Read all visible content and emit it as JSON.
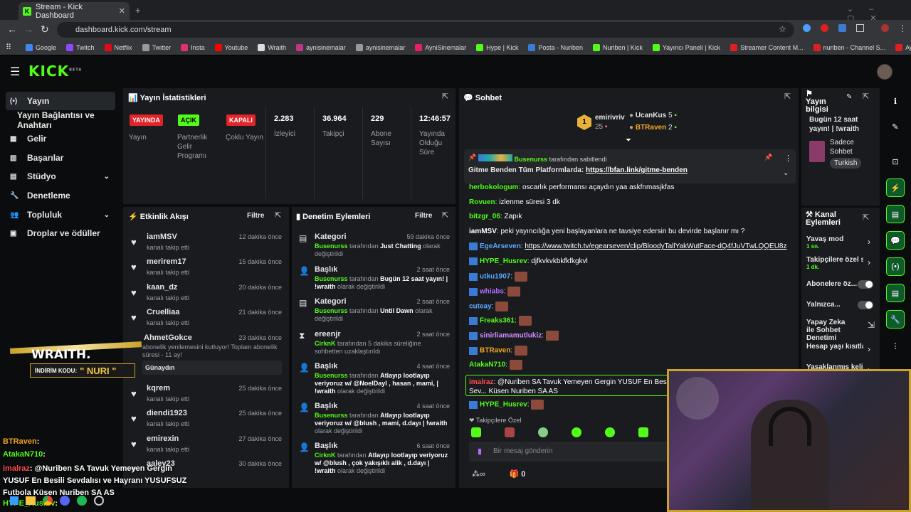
{
  "browser": {
    "tab_title": "Stream - Kick Dashboard",
    "url": "dashboard.kick.com/stream",
    "bookmarks": [
      "Google",
      "Twitch",
      "Netflix",
      "Twitter",
      "Insta",
      "Youtube",
      "Wraith",
      "aynisinemalar",
      "aynisinemalar",
      "AyniSinemalar",
      "Hype | Kick",
      "Posta - Nuriben",
      "Nuriben | Kick",
      "Yayıncı Paneli | Kick",
      "Streamer Content M...",
      "nuriben - Channel S...",
      "Aynı Sinemalar - Ça..."
    ]
  },
  "logo": "KICK",
  "logo_sup": "BETA",
  "sidebar": {
    "items": [
      {
        "label": "Yayın"
      },
      {
        "label": "Yayın Bağlantısı ve Anahtarı"
      },
      {
        "label": "Gelir"
      },
      {
        "label": "Başarılar"
      },
      {
        "label": "Stüdyo"
      },
      {
        "label": "Denetleme"
      },
      {
        "label": "Topluluk"
      },
      {
        "label": "Droplar ve ödüller"
      }
    ]
  },
  "stats": {
    "title": "Yayın İstatistikleri",
    "badges": [
      {
        "badge": "YAYINDA",
        "label": "Yayın"
      },
      {
        "badge": "AÇIK",
        "label": "Partnerlik Gelir Programı"
      },
      {
        "badge": "KAPALI",
        "label": "Çoklu Yayın"
      }
    ],
    "values": [
      {
        "value": "2.283",
        "label": "İzleyici"
      },
      {
        "value": "36.964",
        "label": "Takipçi"
      },
      {
        "value": "229",
        "label": "Abone Sayısı"
      },
      {
        "value": "12:46:57",
        "label": "Yayında Olduğu Süre"
      }
    ]
  },
  "activity": {
    "title": "Etkinlik Akışı",
    "filter": "Filtre",
    "items": [
      {
        "name": "iamMSV",
        "sub": "kanalı takip etti",
        "time": "12 dakika önce"
      },
      {
        "name": "merirem17",
        "sub": "kanalı takip etti",
        "time": "15 dakika önce"
      },
      {
        "name": "kaan_dz",
        "sub": "kanalı takip etti",
        "time": "20 dakika önce"
      },
      {
        "name": "Cruelliaa",
        "sub": "kanalı takip etti",
        "time": "21 dakika önce"
      },
      {
        "name": "AhmetGokce",
        "sub": "abonelik yenilemesini kutluyor! Toplam abonelik süresi - 11 ay!",
        "time": "23 dakika önce",
        "msg": "Günaydın"
      },
      {
        "name": "kqrem",
        "sub": "kanalı takip etti",
        "time": "25 dakika önce"
      },
      {
        "name": "diendi1923",
        "sub": "kanalı takip etti",
        "time": "25 dakika önce"
      },
      {
        "name": "emirexin",
        "sub": "kanalı takip etti",
        "time": "27 dakika önce"
      },
      {
        "name": "aaley23",
        "sub": "",
        "time": "30 dakika önce"
      }
    ]
  },
  "moderation": {
    "title": "Denetim Eylemleri",
    "filter": "Filtre",
    "items": [
      {
        "type": "Kategori",
        "actor": "Busenurss",
        "mid": "tarafından",
        "val": "Just Chatting",
        "end": "olarak değiştirildi",
        "time": "59 dakika önce"
      },
      {
        "type": "Başlık",
        "actor": "Busenurss",
        "mid": "tarafından",
        "val": "Bugün 12 saat yayın! | !wraith",
        "end": "olarak değiştirildi",
        "time": "2 saat önce"
      },
      {
        "type": "Kategori",
        "actor": "Busenurss",
        "mid": "tarafından",
        "val": "Until Dawn",
        "end": "olarak değiştirildi",
        "time": "2 saat önce"
      },
      {
        "type": "ereenjr",
        "actor": "CirknK",
        "mid": "tarafından 5 dakika süreliğine sohbetten uzaklaştırıldı",
        "val": "",
        "end": "",
        "time": "2 saat önce"
      },
      {
        "type": "Başlık",
        "actor": "Busenurss",
        "mid": "tarafından",
        "val": "Atlayıp lootlayıp veriyoruz w/ @NoelDayl , hasan , mami, | !wraith",
        "end": "olarak değiştirildi",
        "time": "4 saat önce"
      },
      {
        "type": "Başlık",
        "actor": "Busenurss",
        "mid": "tarafından",
        "val": "Atlayıp lootlayıp veriyoruz w/ @blush , mami, d.dayı | !wraith",
        "end": "olarak değiştirildi",
        "time": "4 saat önce"
      },
      {
        "type": "Başlık",
        "actor": "CirknK",
        "mid": "tarafından",
        "val": "Atlayıp lootlayıp veriyoruz w/ @blush , çok yakışıklı alik , d.dayı | !wraith",
        "end": "olarak değiştirildi",
        "time": "6 saat önce"
      }
    ]
  },
  "chat": {
    "title": "Sohbet",
    "leaders": [
      {
        "name": "emirivriv",
        "n": "25"
      },
      {
        "name": "UcanKus",
        "n": "5"
      },
      {
        "name": "BTRaven",
        "n": "2"
      }
    ],
    "pinned_by": "Busenurss",
    "pinned_suffix": "tarafından sabitlendi",
    "pinned_text": "Gitme Benden Tüm Platformlarda:",
    "pinned_link": "https://bfan.link/gitme-benden",
    "messages": [
      {
        "user": "herbokologum",
        "color": "#53fc18",
        "text": "oscarlık performansı açaydın yaa askfnmasjkfas"
      },
      {
        "user": "Rovuen",
        "color": "#53fc18",
        "text": "izlenme süresi 3 dk"
      },
      {
        "user": "bitzgr_06",
        "color": "#53fc18",
        "text": "Zapık"
      },
      {
        "user": "iamMSV",
        "color": "#ffffff",
        "text": "peki yayıncılığa yeni başlayanlara ne tavsiye edersin bu devirde başlanır mı ?"
      },
      {
        "user": "EgeArseven",
        "color": "#5aa9ff",
        "text": "https://www.twitch.tv/egearseven/clip/BloodyTallYakWutFace-dQ4fJuVTwLQQEU8z"
      },
      {
        "user": "HYPE_Husrev",
        "color": "#53fc18",
        "text": "djfkvkvkbkfkfkgkvl"
      },
      {
        "user": "utku1907",
        "color": "#5aa9ff",
        "text": ""
      },
      {
        "user": "whiabs",
        "color": "#b16cff",
        "text": ""
      },
      {
        "user": "cuteay",
        "color": "#5aa9ff",
        "text": ""
      },
      {
        "user": "Freaks361",
        "color": "#53fc18",
        "text": ""
      },
      {
        "user": "sinirliamamutlukiz",
        "color": "#d38bff",
        "text": ""
      },
      {
        "user": "BTRaven",
        "color": "#f5a623",
        "text": ""
      },
      {
        "user": "AtakaN710",
        "color": "#53fc18",
        "text": ""
      },
      {
        "user": "imalraz",
        "color": "#ff4d4d",
        "text": "@Nuriben SA Tavuk Yemeyen Gergin YUSUF En Besili Sev... Küsen Nuriben SA AS"
      },
      {
        "user": "HYPE_Husrev",
        "color": "#53fc18",
        "text": ""
      }
    ],
    "followers_only": "Takipçilere Özel",
    "placeholder": "Bir mesaj gönderin",
    "points": "0"
  },
  "stream_info": {
    "title": "Yayın bilgisi",
    "stream_title": "Bugün 12 saat yayın! | !wraith",
    "chat_mode": "Sadece Sohbet",
    "language": "Turkish"
  },
  "channel_actions": {
    "title": "Kanal Eylemleri",
    "items": [
      {
        "label": "Yavaş mod",
        "sub": "1 sn."
      },
      {
        "label": "Takipçilere özel s...",
        "sub": "1 dk."
      },
      {
        "label": "Abonelere öz...",
        "sub": ""
      },
      {
        "label": "Yalnızca...",
        "sub": ""
      },
      {
        "label": "Yapay Zeka ile Sohbet Denetimi",
        "sub": ""
      },
      {
        "label": "Hesap yaşı kısıtla",
        "sub": ""
      },
      {
        "label": "Yasaklanmış kelim...",
        "sub": ""
      }
    ]
  },
  "overlay": {
    "promo_brand": "WRAITH.",
    "promo_code_label": "İNDİRİM KODU:",
    "promo_code": "\" NURI \"",
    "chat": [
      {
        "user": "BTRaven",
        "text": ":"
      },
      {
        "user": "AtakaN710",
        "text": ":"
      },
      {
        "user": "imalraz",
        "text": ": @Nuriben SA Tavuk Yemeyen Gergin YUSUF En Besili Sevdalısı ve Hayranı YUSUFSUZ Futbola Küsen Nuriben SA AS"
      },
      {
        "user": "HYPE_Husrev",
        "text": ":"
      }
    ]
  }
}
